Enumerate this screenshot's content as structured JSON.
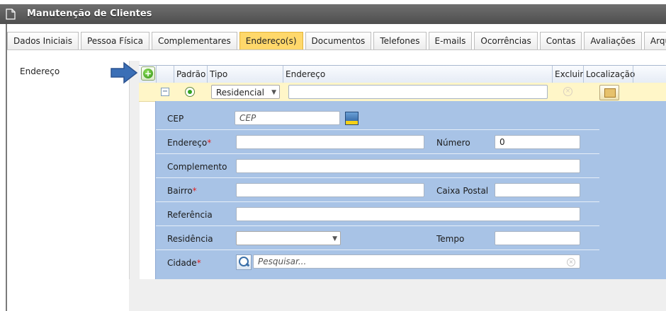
{
  "window": {
    "title": "Manutenção de Clientes"
  },
  "tabs": [
    {
      "label": "Dados Iniciais"
    },
    {
      "label": "Pessoa Física"
    },
    {
      "label": "Complementares"
    },
    {
      "label": "Endereço(s)",
      "active": true
    },
    {
      "label": "Documentos"
    },
    {
      "label": "Telefones"
    },
    {
      "label": "E-mails"
    },
    {
      "label": "Ocorrências"
    },
    {
      "label": "Contas"
    },
    {
      "label": "Avaliações"
    },
    {
      "label": "Arquivos"
    }
  ],
  "section_label": "Endereço",
  "grid": {
    "headers": {
      "padrao": "Padrão",
      "tipo": "Tipo",
      "endereco": "Endereço",
      "excluir": "Excluir",
      "localizacao": "Localização"
    },
    "row": {
      "collapse_symbol": "−",
      "tipo_value": "Residencial",
      "endereco_value": ""
    }
  },
  "form": {
    "cep_label": "CEP",
    "cep_placeholder": "CEP",
    "endereco_label": "Endereço",
    "numero_label": "Número",
    "numero_value": "0",
    "complemento_label": "Complemento",
    "bairro_label": "Bairro",
    "caixa_postal_label": "Caixa Postal",
    "referencia_label": "Referência",
    "residencia_label": "Residência",
    "residencia_value": "",
    "tempo_label": "Tempo",
    "cidade_label": "Cidade",
    "cidade_placeholder": "Pesquisar...",
    "required_marker": "*"
  },
  "colors": {
    "active_tab": "#ffd86b",
    "selected_row": "#fff6c8",
    "detail_panel": "#a8c3e6",
    "required": "#e02020",
    "arrow": "#3b6fb6"
  },
  "icons": [
    "document-icon",
    "arrow-right-icon",
    "add-icon",
    "radio-selected-icon",
    "delete-icon",
    "map-icon",
    "correios-icon",
    "search-icon",
    "clear-icon"
  ]
}
